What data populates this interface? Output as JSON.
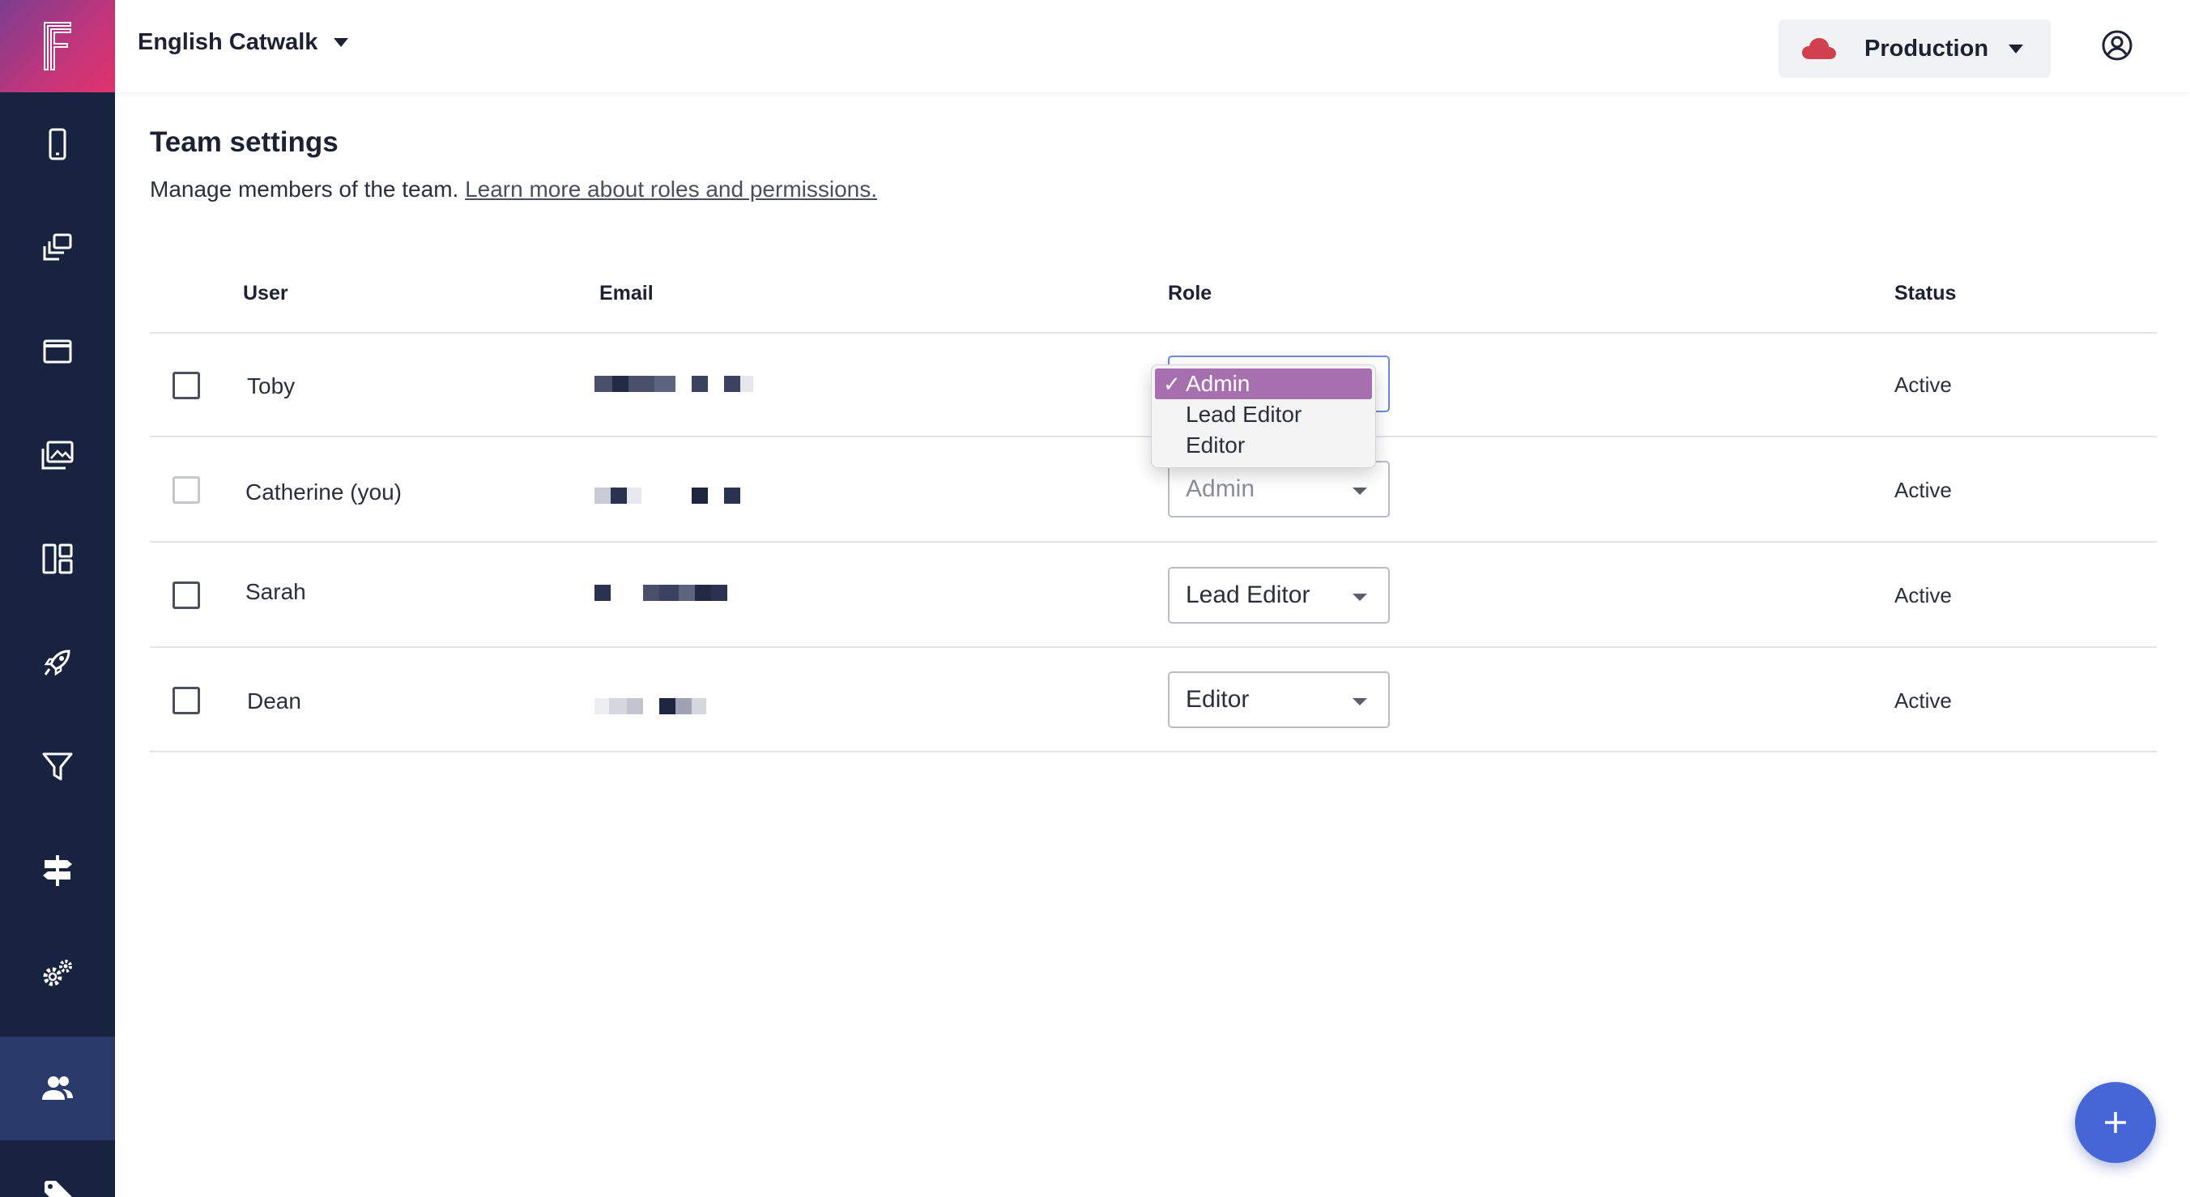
{
  "topbar": {
    "project_name": "English Catwalk",
    "environment": "Production"
  },
  "sidebar": {
    "items": [
      {
        "name": "mobile",
        "icon": "mobile-icon"
      },
      {
        "name": "collections",
        "icon": "stack-icon"
      },
      {
        "name": "screens",
        "icon": "window-icon"
      },
      {
        "name": "media",
        "icon": "images-icon"
      },
      {
        "name": "layouts",
        "icon": "layout-icon"
      },
      {
        "name": "launch",
        "icon": "rocket-icon"
      },
      {
        "name": "filters",
        "icon": "filter-icon"
      },
      {
        "name": "routing",
        "icon": "signpost-icon"
      },
      {
        "name": "settings",
        "icon": "gears-icon"
      },
      {
        "name": "team",
        "icon": "users-icon",
        "active": true
      },
      {
        "name": "tags",
        "icon": "tag-icon"
      }
    ]
  },
  "page": {
    "title": "Team settings",
    "subtitle": "Manage members of the team.",
    "link": "Learn more about roles and permissions."
  },
  "table": {
    "headers": {
      "user": "User",
      "email": "Email",
      "role": "Role",
      "status": "Status"
    },
    "rows": [
      {
        "user": "Toby",
        "role": "Admin",
        "status": "Active"
      },
      {
        "user": "Catherine (you)",
        "role": "Admin",
        "status": "Active"
      },
      {
        "user": "Sarah",
        "role": "Lead Editor",
        "status": "Active"
      },
      {
        "user": "Dean",
        "role": "Editor",
        "status": "Active"
      }
    ]
  },
  "dropdown": {
    "options": [
      "Admin",
      "Lead Editor",
      "Editor"
    ],
    "selected": "Admin",
    "check": "✓"
  },
  "fab": {
    "label": "+"
  },
  "colors": {
    "sidebar": "#182340",
    "accent": "#4666d6",
    "selected_option": "#a66fae",
    "cloud": "#d0404e"
  }
}
